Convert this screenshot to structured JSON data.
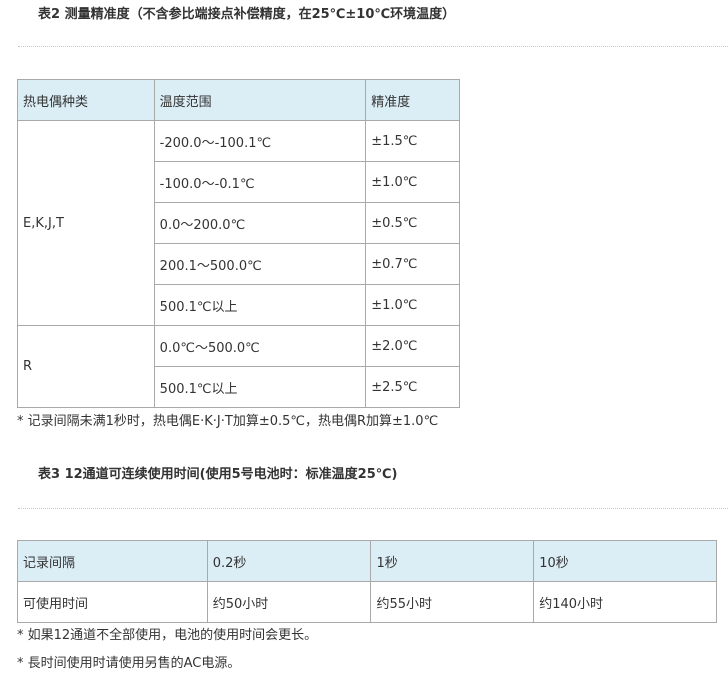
{
  "table2": {
    "title": "表2 测量精准度（不含参比端接点补偿精度，在25℃±10℃环境温度）",
    "headers": [
      "热电偶种类",
      "温度范围",
      "精准度"
    ],
    "groups": [
      {
        "type": "E,K,J,T",
        "rows": [
          {
            "range": "-200.0～-100.1℃",
            "accuracy": "±1.5℃"
          },
          {
            "range": "-100.0～-0.1℃",
            "accuracy": "±1.0℃"
          },
          {
            "range": "0.0～200.0℃",
            "accuracy": "±0.5℃"
          },
          {
            "range": "200.1～500.0℃",
            "accuracy": "±0.7℃"
          },
          {
            "range": "500.1℃以上",
            "accuracy": "±1.0℃"
          }
        ]
      },
      {
        "type": "R",
        "rows": [
          {
            "range": "0.0℃～500.0℃",
            "accuracy": "±2.0℃"
          },
          {
            "range": "500.1℃以上",
            "accuracy": "±2.5℃"
          }
        ]
      }
    ],
    "note": "* 记录间隔未满1秒时，热电偶E·K·J·T加算±0.5℃，热电偶R加算±1.0℃"
  },
  "table3": {
    "title": "表3 12通道可连续使用时间(使用5号电池时：标准温度25℃)",
    "header_row": [
      "记录间隔",
      "0.2秒",
      "1秒",
      "10秒"
    ],
    "body_row": [
      "可使用时间",
      "约50小时",
      "约55小时",
      "约140小时"
    ],
    "notes": [
      "* 如果12通道不全部使用，电池的使用时间会更长。",
      "* 長时间使用时请使用另售的AC电源。"
    ]
  },
  "colors": {
    "header_bg": "#dbedf5",
    "border": "#a9a9a9",
    "text": "#333333"
  }
}
